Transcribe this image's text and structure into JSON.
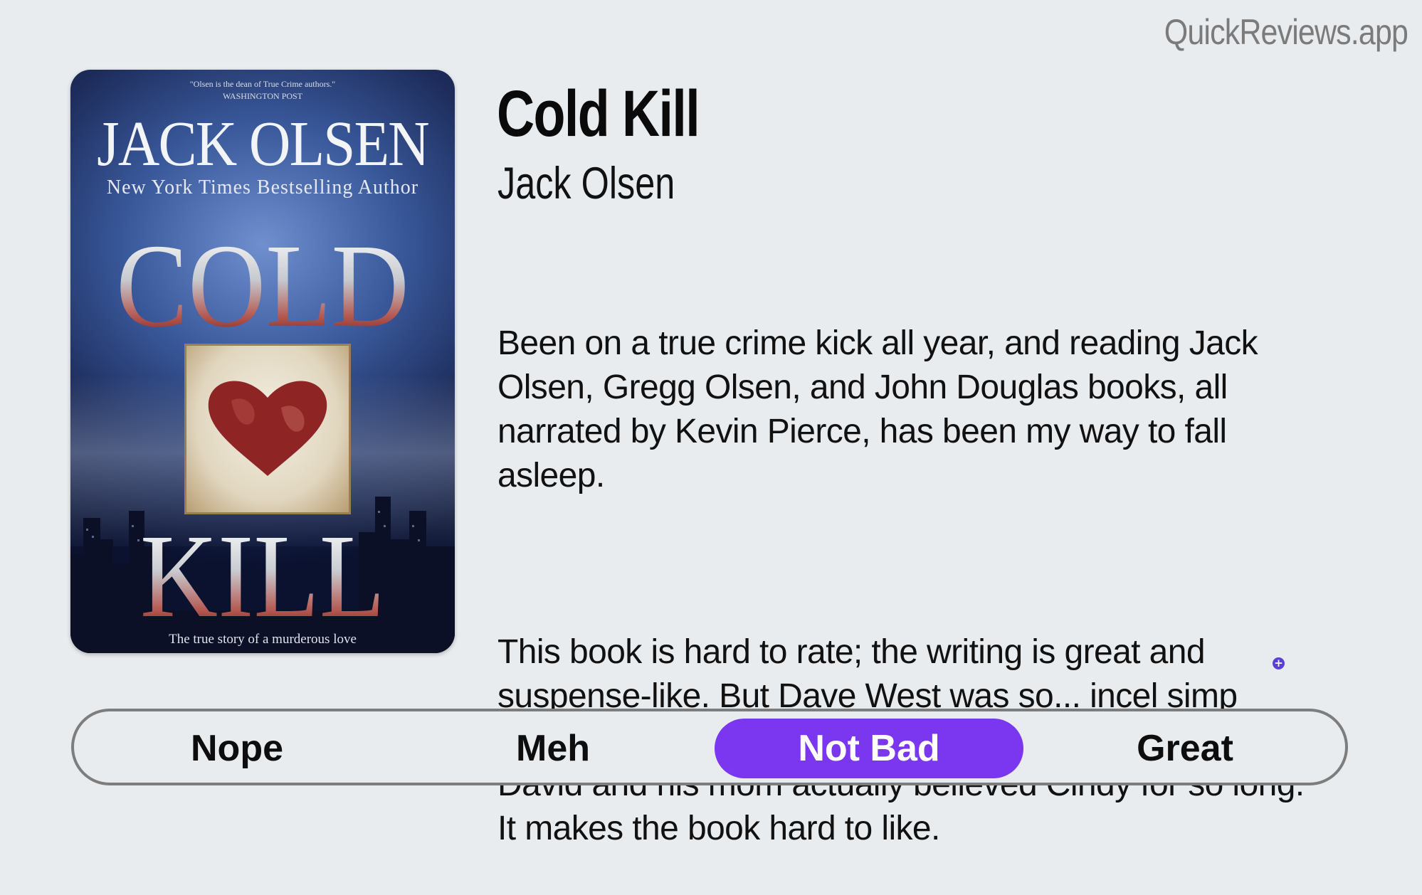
{
  "brand": "QuickReviews.app",
  "book": {
    "title": "Cold Kill",
    "author": "Jack Olsen",
    "cover": {
      "quote_line1": "\"Olsen is the dean of True Crime authors.\"",
      "quote_line2": "WASHINGTON POST",
      "author": "JACK OLSEN",
      "tagline": "New York Times Bestselling Author",
      "word1": "COLD",
      "word2": "KILL",
      "subtitle": "The true story of a murderous love"
    }
  },
  "review": {
    "paragraph1": "Been on a true crime kick all year, and reading Jack Olsen, Gregg Olsen, and John Douglas books, all narrated by Kevin Pierce, has been my way to fall asleep.",
    "paragraph2": "This book is hard to rate; the writing is great and suspense-like. But Dave West was so... incel simp dumb. And Cindy Campbell... I don't understand how David and his mom actually believed Cindy for so long. It makes the book hard to like."
  },
  "expand_icon": "plus-circle-icon",
  "rating": {
    "options": [
      "Nope",
      "Meh",
      "Not Bad",
      "Great"
    ],
    "selected": "Not Bad",
    "accent_color": "#7b36f0"
  }
}
